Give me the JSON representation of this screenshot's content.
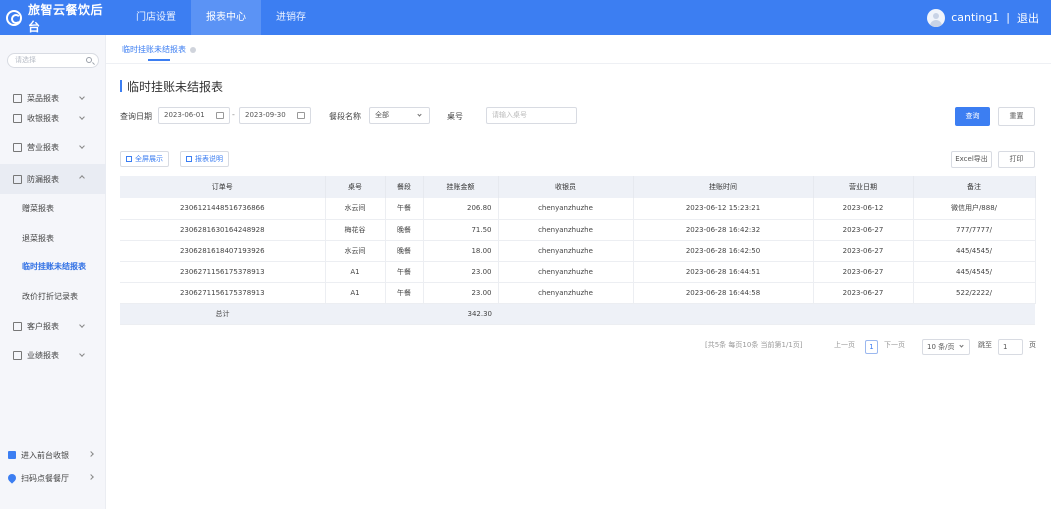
{
  "brand": {
    "name": "旅智云餐饮后台"
  },
  "nav": [
    {
      "label": "门店设置"
    },
    {
      "label": "报表中心"
    },
    {
      "label": "进销存"
    }
  ],
  "user": {
    "name": "canting1",
    "separator": "|",
    "logout": "退出"
  },
  "sidebar": {
    "search_placeholder": "请选择",
    "menus": [
      {
        "label": "菜品报表"
      },
      {
        "label": "收银报表"
      },
      {
        "label": "营业报表"
      },
      {
        "label": "防漏报表"
      },
      {
        "label": "客户报表"
      },
      {
        "label": "业绩报表"
      }
    ],
    "sub_items": [
      {
        "label": "赠菜报表"
      },
      {
        "label": "退菜报表"
      },
      {
        "label": "临时挂账未结报表"
      },
      {
        "label": "改价打折记录表"
      }
    ],
    "bottom": [
      {
        "label": "进入前台收银"
      },
      {
        "label": "扫码点餐餐厅"
      }
    ]
  },
  "tab": {
    "label": "临时挂账未结报表"
  },
  "page": {
    "title": "临时挂账未结报表"
  },
  "filters": {
    "date_label": "查询日期",
    "date_start": "2023-06-01",
    "date_dash": "-",
    "date_end": "2023-09-30",
    "meal_label": "餐段名称",
    "meal_value": "全部",
    "table_label": "桌号",
    "table_placeholder": "请输入桌号",
    "search_btn": "查询",
    "reset_btn": "重置"
  },
  "toolbar": {
    "fullscreen": "全屏展示",
    "report_desc": "报表说明",
    "excel": "Excel导出",
    "print": "打印"
  },
  "table": {
    "headers": [
      "订单号",
      "桌号",
      "餐段",
      "挂账金额",
      "收银员",
      "挂账时间",
      "营业日期",
      "备注"
    ],
    "rows": [
      [
        "2306121448516736866",
        "水云间",
        "午餐",
        "206.80",
        "chenyanzhuzhe",
        "2023-06-12 15:23:21",
        "2023-06-12",
        "微信用户/888/"
      ],
      [
        "2306281630164248928",
        "梅花谷",
        "晚餐",
        "71.50",
        "chenyanzhuzhe",
        "2023-06-28 16:42:32",
        "2023-06-27",
        "777/7777/"
      ],
      [
        "2306281618407193926",
        "水云间",
        "晚餐",
        "18.00",
        "chenyanzhuzhe",
        "2023-06-28 16:42:50",
        "2023-06-27",
        "445/4545/"
      ],
      [
        "2306271156175378913",
        "A1",
        "午餐",
        "23.00",
        "chenyanzhuzhe",
        "2023-06-28 16:44:51",
        "2023-06-27",
        "445/4545/"
      ],
      [
        "2306271156175378913",
        "A1",
        "午餐",
        "23.00",
        "chenyanzhuzhe",
        "2023-06-28 16:44:58",
        "2023-06-27",
        "522/2222/"
      ]
    ],
    "total_label": "总计",
    "total_amount": "342.30"
  },
  "pagination": {
    "summary": "[共5条 每页10条 当前第1/1页]",
    "prev": "上一页",
    "current": "1",
    "next": "下一页",
    "page_size": "10 条/页",
    "goto_label": "跳至",
    "goto_value": "1",
    "page_unit": "页"
  },
  "colors": {
    "primary": "#3c7ef2",
    "header_bg": "#eef1f7",
    "sidebar_bg": "#f5f6fa"
  }
}
